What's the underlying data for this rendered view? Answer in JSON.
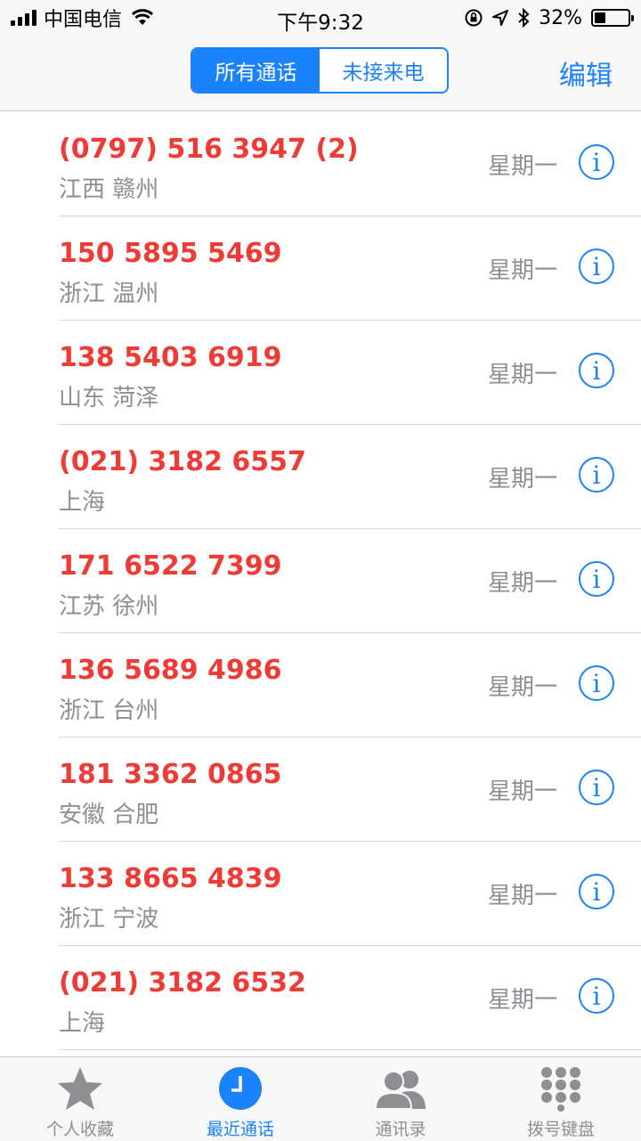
{
  "status_bar": {
    "carrier": "中国电信",
    "time": "下午9:32",
    "battery_percent": "32%",
    "battery_level": 0.32,
    "icons": [
      "signal-icon",
      "wifi-icon",
      "orientation-lock-icon",
      "location-icon",
      "bluetooth-icon",
      "battery-icon"
    ]
  },
  "nav": {
    "segments": [
      "所有通话",
      "未接来电"
    ],
    "active_segment": 0,
    "edit_label": "编辑"
  },
  "calls": [
    {
      "number": "(0797) 516 3947 (2)",
      "location": "江西 赣州",
      "day": "星期一"
    },
    {
      "number": "150 5895 5469",
      "location": "浙江 温州",
      "day": "星期一"
    },
    {
      "number": "138 5403 6919",
      "location": "山东 菏泽",
      "day": "星期一"
    },
    {
      "number": "(021) 3182 6557",
      "location": "上海",
      "day": "星期一"
    },
    {
      "number": "171 6522 7399",
      "location": "江苏 徐州",
      "day": "星期一"
    },
    {
      "number": "136 5689 4986",
      "location": "浙江 台州",
      "day": "星期一"
    },
    {
      "number": "181 3362 0865",
      "location": "安徽 合肥",
      "day": "星期一"
    },
    {
      "number": "133 8665 4839",
      "location": "浙江 宁波",
      "day": "星期一"
    },
    {
      "number": "(021) 3182 6532",
      "location": "上海",
      "day": "星期一"
    }
  ],
  "info_glyph": "i",
  "colors": {
    "accent": "#1a82fb",
    "missed_call": "#ef3b36",
    "secondary_text": "#8e8e93"
  },
  "tabs": [
    {
      "label": "个人收藏",
      "icon": "star-icon"
    },
    {
      "label": "最近通话",
      "icon": "clock-icon"
    },
    {
      "label": "通讯录",
      "icon": "contacts-icon"
    },
    {
      "label": "拨号键盘",
      "icon": "keypad-icon"
    }
  ],
  "active_tab": 1
}
